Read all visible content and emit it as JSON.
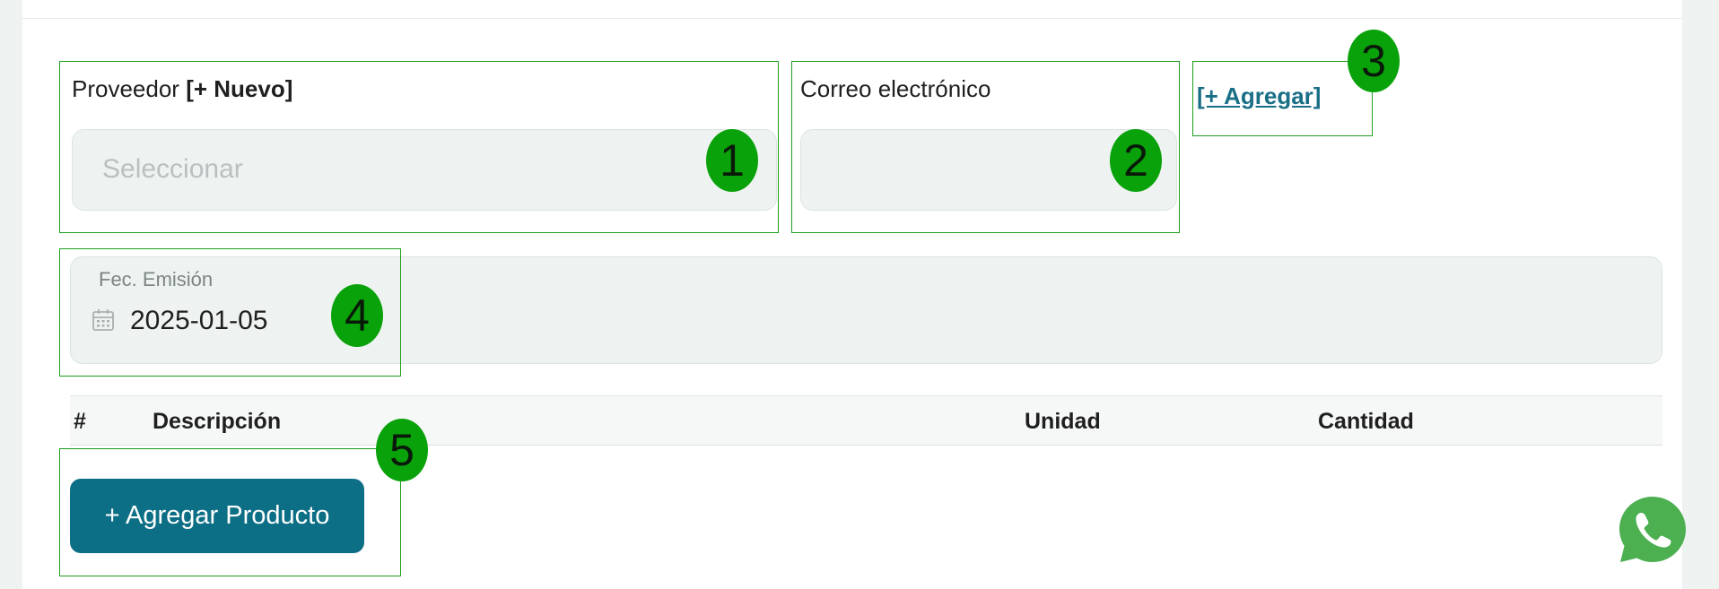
{
  "proveedor": {
    "label": "Proveedor",
    "new_link": "[+ Nuevo]",
    "placeholder": "Seleccionar"
  },
  "correo": {
    "label": "Correo electrónico",
    "value": ""
  },
  "agregar_link": "[+ Agregar]",
  "fecha": {
    "label": "Fec. Emisión",
    "value": "2025-01-05"
  },
  "table": {
    "headers": [
      "#",
      "Descripción",
      "Unidad",
      "Cantidad"
    ]
  },
  "add_product_button": "+ Agregar Producto",
  "annotations": [
    "1",
    "2",
    "3",
    "4",
    "5"
  ],
  "colors": {
    "accent": "#0d6f86",
    "link": "#1a6f86",
    "annotation_green": "#0aa20a",
    "whatsapp": "#4caf50"
  },
  "icons": [
    "calendar-icon",
    "whatsapp-icon"
  ]
}
